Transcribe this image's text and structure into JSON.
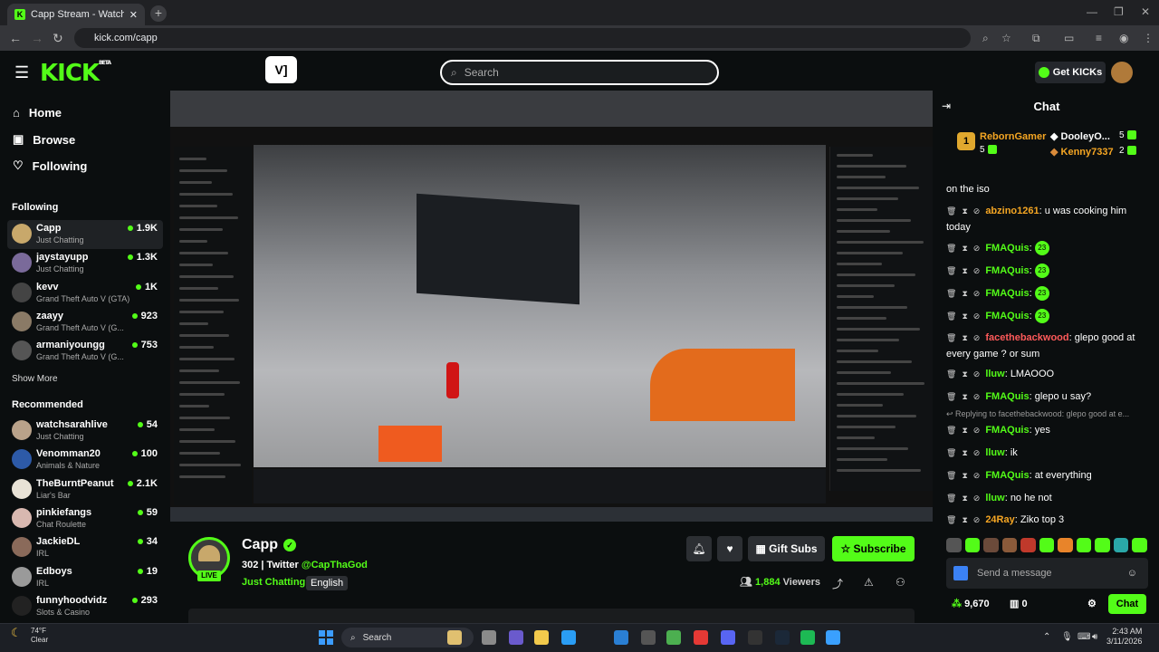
{
  "browser": {
    "tab_title": "Capp Stream - Watch Live on Kick",
    "url": "kick.com/capp",
    "new_tab": "+"
  },
  "header": {
    "logo": "KICK",
    "logo_sup": "BETA",
    "search_placeholder": "Search",
    "get_kicks": "Get KICKs",
    "ext_label": "V]"
  },
  "sidebar": {
    "nav": [
      {
        "label": "Home",
        "icon": "home-icon"
      },
      {
        "label": "Browse",
        "icon": "browse-icon"
      },
      {
        "label": "Following",
        "icon": "heart-icon"
      }
    ],
    "following_heading": "Following",
    "following": [
      {
        "name": "Capp",
        "category": "Just Chatting",
        "viewers": "1.9K",
        "color": "#c8a86b"
      },
      {
        "name": "jaystayupp",
        "category": "Just Chatting",
        "viewers": "1.3K",
        "color": "#7a6a9a"
      },
      {
        "name": "kevv",
        "category": "Grand Theft Auto V (GTA)",
        "viewers": "1K",
        "color": "#444"
      },
      {
        "name": "zaayy",
        "category": "Grand Theft Auto V (G...",
        "viewers": "923",
        "color": "#8a7a66"
      },
      {
        "name": "armaniyoungg",
        "category": "Grand Theft Auto V (G...",
        "viewers": "753",
        "color": "#555"
      }
    ],
    "show_more": "Show More",
    "recommended_heading": "Recommended",
    "recommended": [
      {
        "name": "watchsarahlive",
        "category": "Just Chatting",
        "viewers": "54",
        "color": "#b9a28a"
      },
      {
        "name": "Venomman20",
        "category": "Animals & Nature",
        "viewers": "100",
        "color": "#2d5aa8"
      },
      {
        "name": "TheBurntPeanut",
        "category": "Liar's Bar",
        "viewers": "2.1K",
        "color": "#e8e2d6"
      },
      {
        "name": "pinkiefangs",
        "category": "Chat Roulette",
        "viewers": "59",
        "color": "#d8b8b0"
      },
      {
        "name": "JackieDL",
        "category": "IRL",
        "viewers": "34",
        "color": "#8a6a5a"
      },
      {
        "name": "Edboys",
        "category": "IRL",
        "viewers": "19",
        "color": "#9a9a9a"
      },
      {
        "name": "funnyhoodvidz",
        "category": "Slots & Casino",
        "viewers": "293",
        "color": "#222"
      }
    ]
  },
  "stream": {
    "name": "Capp",
    "live": "LIVE",
    "followers_prefix": "302 | Twitter ",
    "twitter": "@CapThaGod",
    "category": "Just Chatting",
    "language": "English",
    "gift_subs": "Gift Subs",
    "subscribe": "Subscribe",
    "viewers_count": "1,884",
    "viewers_label": "Viewers"
  },
  "chat": {
    "title": "Chat",
    "leaderboard": {
      "first": {
        "rank": "1",
        "name": "RebornGamer",
        "count": "5"
      },
      "second": {
        "name": "DooleyO...",
        "count": "5"
      },
      "third": {
        "name": "Kenny7337",
        "count": "2"
      }
    },
    "top_fragment": "on the iso",
    "messages": [
      {
        "user": "abzino1261",
        "text": ": u was cooking him today",
        "color": "#f5a623"
      },
      {
        "user": "FMAQuis",
        "text": ":",
        "color": "#53fc18",
        "emote": true
      },
      {
        "user": "FMAQuis",
        "text": ":",
        "color": "#53fc18",
        "emote": true
      },
      {
        "user": "FMAQuis",
        "text": ":",
        "color": "#53fc18",
        "emote": true
      },
      {
        "user": "FMAQuis",
        "text": ":",
        "color": "#53fc18",
        "emote": true
      },
      {
        "user": "facethebackwood",
        "text": ": glepo good at every game ? or sum",
        "color": "#ff5a5a"
      },
      {
        "user": "lluw",
        "text": ": LMAOOO",
        "color": "#53fc18"
      },
      {
        "user": "FMAQuis",
        "text": ": glepo u say?",
        "color": "#53fc18"
      },
      {
        "user": "FMAQuis",
        "text": ": yes",
        "color": "#53fc18"
      },
      {
        "user": "lluw",
        "text": ": ik",
        "color": "#53fc18"
      },
      {
        "user": "FMAQuis",
        "text": ": at everything",
        "color": "#53fc18"
      },
      {
        "user": "lluw",
        "text": ": no he not",
        "color": "#53fc18"
      },
      {
        "user": "24Ray",
        "text": ": Ziko top 3",
        "color": "#f5a623"
      }
    ],
    "reply_text": "Replying to facethebackwood: glepo good at e...",
    "emote_label": "23",
    "input_placeholder": "Send a message",
    "kicks_balance": "9,670",
    "second_balance": "0",
    "chat_button": "Chat"
  },
  "taskbar": {
    "temp": "74°F",
    "weather": "Clear",
    "search": "Search",
    "time": "2:43 AM",
    "date": "3/11/2026"
  }
}
